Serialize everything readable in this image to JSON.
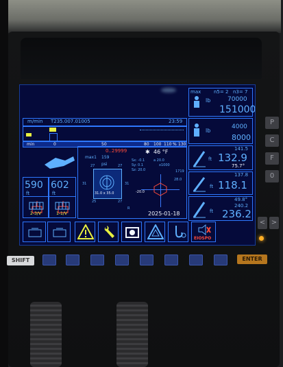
{
  "top_bar": {
    "unit": "m/min",
    "code": "T235.007.01005",
    "time": "23:59",
    "scale": [
      "min",
      "0",
      "50",
      "80",
      "100",
      "110",
      "%",
      "130"
    ]
  },
  "load_box": {
    "max_label": "max",
    "n1": "n5= 2",
    "n2": "n3= 7",
    "unit": "lb",
    "max_load": "70000",
    "load": "151000"
  },
  "load_box2": {
    "unit": "lb",
    "top": "4000",
    "bottom": "8000"
  },
  "radius_left": {
    "value": "590",
    "unit": "ft"
  },
  "radius_right": {
    "value": "602",
    "unit": "ft"
  },
  "winch_labels": [
    "2-3/V",
    "1-1/V"
  ],
  "center": {
    "red_value": "0..29999",
    "max_label": "max1",
    "max_val": "159",
    "psi_label": "psi",
    "temp": "46 °F",
    "sx": "Sx: -0.1",
    "sy": "Sy: 0.1",
    "sz": "Sz: 20.0",
    "a": "a 20.0",
    "x": "x1000",
    "bottom_val": "31.0 x 35.0",
    "left_vals": [
      "31",
      "31"
    ],
    "top_vals": [
      "27",
      "27"
    ],
    "bottom_nums": [
      "25",
      "27",
      "R"
    ],
    "right_vals": [
      "28.0",
      "1719"
    ],
    "n20": "-20.0",
    "date": "2025-01-18"
  },
  "boom_panels": [
    {
      "label": "ft",
      "small": "141.5",
      "big": "132.9",
      "angle": "75.7°"
    },
    {
      "label": "ft",
      "small": "137.8",
      "big": "118.1",
      "angle": ""
    },
    {
      "label": "ft",
      "small": "49.8°",
      "mid": "240.2",
      "big": "236.2",
      "angle": ""
    }
  ],
  "bottom_buttons": [
    {
      "name": "winch-1",
      "icon": "winch-icon"
    },
    {
      "name": "winch-2",
      "icon": "winch-icon"
    },
    {
      "name": "warning",
      "icon": "warning-icon"
    },
    {
      "name": "wrench",
      "icon": "wrench-icon"
    },
    {
      "name": "winch-drum",
      "icon": "drum-icon"
    },
    {
      "name": "alarm",
      "icon": "alert-triangle-icon"
    },
    {
      "name": "hook",
      "icon": "hook-icon"
    },
    {
      "name": "mute",
      "icon": "mute-icon",
      "label": "EIOSPO"
    }
  ],
  "keys": {
    "shift": "SHIFT",
    "enter": "ENTER"
  },
  "side_keys": [
    "P",
    "C",
    "F",
    "0",
    "<",
    ">"
  ],
  "colors": {
    "screen_bg": "#050a3a",
    "line": "#2e78ff",
    "text": "#5fb0ff",
    "warn": "#e8f040",
    "alert": "#ff4b3a"
  }
}
